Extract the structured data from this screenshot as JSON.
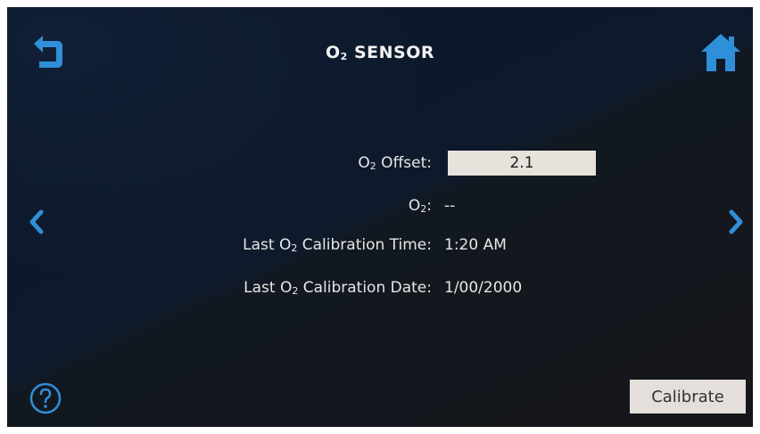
{
  "header": {
    "title_pre": "O",
    "title_sub": "2",
    "title_post": " SENSOR",
    "back_icon": "back-arrow-icon",
    "home_icon": "home-icon"
  },
  "fields": {
    "offset": {
      "label_pre": "O",
      "label_sub": "2",
      "label_post": " Offset:",
      "value": "2.1"
    },
    "o2": {
      "label_pre": "O",
      "label_sub": "2",
      "label_post": ":",
      "value": "--"
    },
    "cal_time": {
      "label_pre": "Last O",
      "label_sub": "2",
      "label_post": " Calibration Time:",
      "value": "1:20 AM"
    },
    "cal_date": {
      "label_pre": "Last O",
      "label_sub": "2",
      "label_post": " Calibration Date:",
      "value": "1/00/2000"
    }
  },
  "nav": {
    "prev_icon": "chevron-left-icon",
    "next_icon": "chevron-right-icon",
    "help_icon": "help-circle-icon"
  },
  "actions": {
    "calibrate_label": "Calibrate"
  },
  "colors": {
    "accent": "#2f8fd8",
    "text": "#e6e6e6",
    "input_bg": "#e8e2dc"
  }
}
